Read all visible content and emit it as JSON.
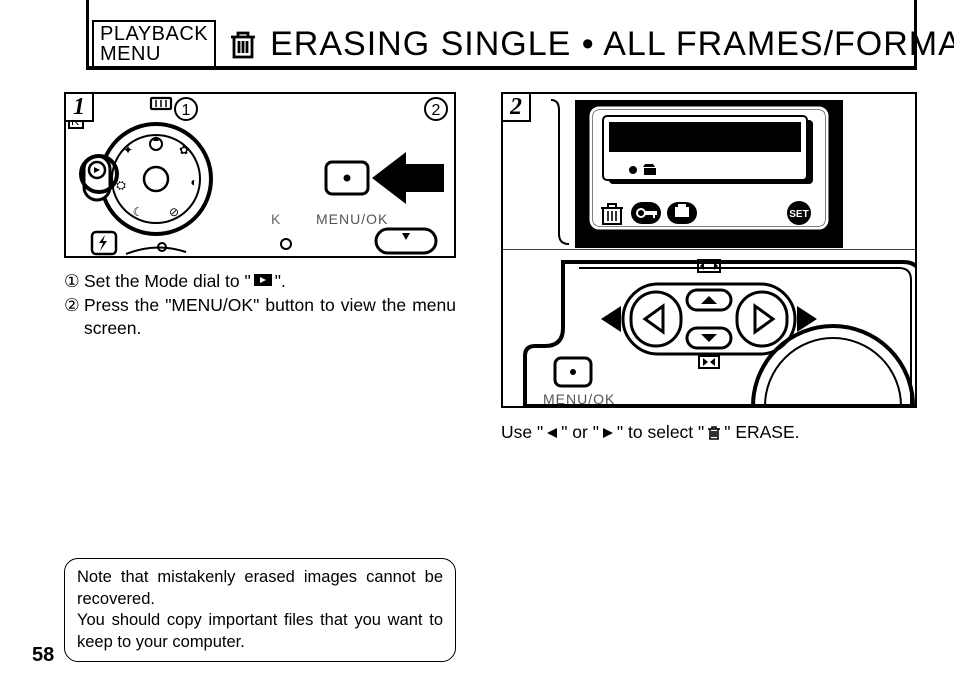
{
  "header": {
    "badge": "PLAYBACK MENU",
    "title": "ERASING SINGLE • ALL FRAMES/FORMATTING"
  },
  "step1": {
    "num": "1",
    "line1_prefix": "Set the Mode dial to \"",
    "line1_suffix": "\".",
    "line2": "Press the \"MENU/OK\" button to view the menu screen.",
    "marker1": "1",
    "marker2": "2"
  },
  "step2": {
    "num": "2",
    "caption_a": "Use \"",
    "caption_b": "\" or \"",
    "caption_c": "\" to select \"",
    "caption_d": "\" ERASE.",
    "lcd_set": "SET",
    "menuok": "MENU/OK"
  },
  "note": {
    "line1": "Note that mistakenly erased images cannot be recovered.",
    "line2": "You should copy important files that you want to keep to your computer."
  },
  "page_number": "58",
  "circled": {
    "one": "①",
    "two": "②"
  }
}
